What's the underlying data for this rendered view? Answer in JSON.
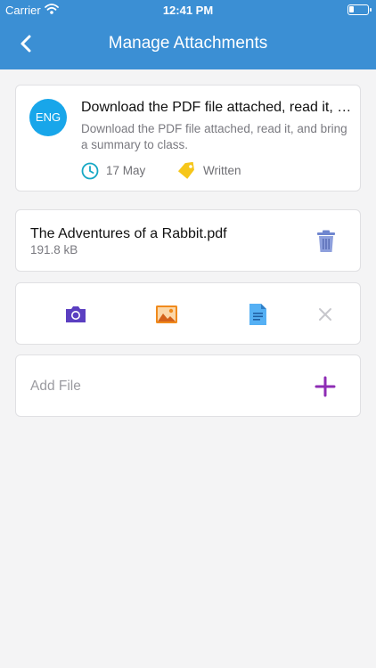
{
  "status_bar": {
    "carrier": "Carrier",
    "time": "12:41 PM"
  },
  "nav": {
    "title": "Manage Attachments",
    "back_icon": "chevron-left-icon"
  },
  "assignment": {
    "subject": "ENG",
    "title": "Download the PDF file attached, read it, and bring a summary to class.",
    "description": "Download the PDF file attached, read it, and bring a summary to class.",
    "date": "17 May",
    "type": "Written",
    "colors": {
      "subject_badge": "#18a6ea",
      "clock": "#15a7c4",
      "tag": "#f6c61a"
    }
  },
  "attachment": {
    "name": "The Adventures of a Rabbit.pdf",
    "size": "191.8 kB"
  },
  "actions": {
    "items": [
      {
        "name": "camera-icon",
        "color": "#5b3fc1"
      },
      {
        "name": "image-icon",
        "color": "#f08a1c"
      },
      {
        "name": "document-icon",
        "color": "#3f9ee8"
      },
      {
        "name": "close-icon",
        "color": "#c7c7cc"
      }
    ]
  },
  "add_file": {
    "label": "Add File",
    "icon_color": "#8e2cb4"
  },
  "colors": {
    "header": "#3b8fd4",
    "background": "#f4f4f5"
  }
}
